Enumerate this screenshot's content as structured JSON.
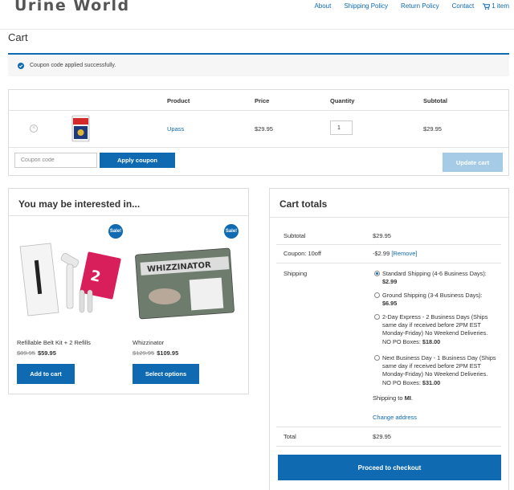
{
  "site": {
    "logo": "Urine World",
    "nav": [
      {
        "label": "About"
      },
      {
        "label": "Shipping Policy"
      },
      {
        "label": "Return Policy"
      },
      {
        "label": "Contact"
      }
    ],
    "cart_link": "1 item"
  },
  "page": {
    "title": "Cart"
  },
  "notice": {
    "text": "Coupon code applied successfully."
  },
  "cart_table": {
    "headers": {
      "product": "Product",
      "price": "Price",
      "quantity": "Quantity",
      "subtotal": "Subtotal"
    },
    "items": [
      {
        "remove": "×",
        "thumb_text": "UPASS",
        "name": "Upass",
        "price": "$29.95",
        "quantity": "1",
        "subtotal": "$29.95"
      }
    ],
    "coupon_placeholder": "Coupon code",
    "apply_label": "Apply coupon",
    "update_label": "Update cart"
  },
  "interest": {
    "title": "You may be interested in...",
    "products": [
      {
        "sale": "Sale!",
        "name": "Refillable Belt Kit + 2 Refills",
        "old_price": "$89.95",
        "new_price": "$59.95",
        "button": "Add to cart"
      },
      {
        "sale": "Sale!",
        "name": "Whizzinator",
        "old_price": "$129.95",
        "new_price": "$109.95",
        "button": "Select options"
      }
    ]
  },
  "totals": {
    "title": "Cart totals",
    "subtotal_label": "Subtotal",
    "subtotal_value": "$29.95",
    "coupon_label": "Coupon: 10off",
    "coupon_value": "-$2.99",
    "coupon_remove": "[Remove]",
    "shipping_label": "Shipping",
    "shipping_options": [
      {
        "text": "Standard Shipping (4-6 Business Days):",
        "price": "$2.99",
        "selected": true
      },
      {
        "text": "Ground Shipping (3-4 Business Days):",
        "price": "$6.95",
        "selected": false
      },
      {
        "text": "2-Day Express - 2 Business Days (Ships same day if received before 2PM EST Monday-Friday) No Weekend Deliveries. NO PO Boxes:",
        "price": "$18.00",
        "selected": false
      },
      {
        "text": "Next Business Day - 1 Business Day (Ships same day if received before 2PM EST Monday-Friday) No Weekend Deliveries. NO PO Boxes:",
        "price": "$31.00",
        "selected": false
      }
    ],
    "ship_to_prefix": "Shipping to",
    "ship_to_state": "MI",
    "change_address": "Change address",
    "total_label": "Total",
    "total_value": "$29.95",
    "checkout_label": "Proceed to checkout"
  },
  "colors": {
    "accent": "#0f6ab2",
    "accent_light": "#a5cbe6",
    "notice_bg": "#f7f6f7"
  },
  "icons": [
    "check-circle-icon",
    "cart-icon",
    "remove-icon"
  ]
}
